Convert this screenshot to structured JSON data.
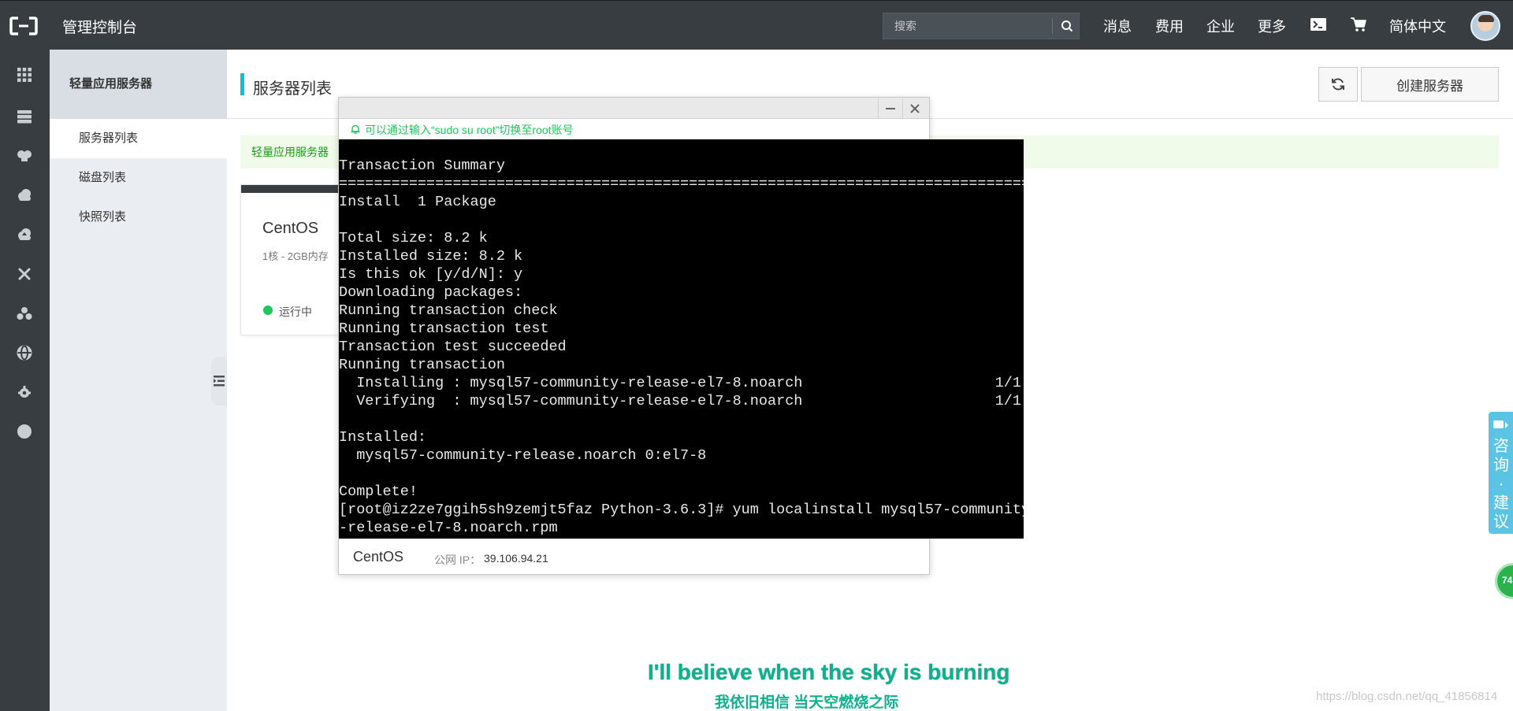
{
  "header": {
    "app_title": "管理控制台",
    "search_placeholder": "搜索",
    "nav": [
      "消息",
      "费用",
      "企业",
      "更多"
    ],
    "language": "简体中文"
  },
  "rail_icons": [
    "apps-grid-icon",
    "database-icon",
    "cloud-server-icon",
    "cloud-icon",
    "cloud-upload-icon",
    "tools-icon",
    "cluster-icon",
    "globe-icon",
    "settings-gear-icon",
    "circle-icon"
  ],
  "sidebar": {
    "header": "轻量应用服务器",
    "items": [
      {
        "label": "服务器列表",
        "active": true
      },
      {
        "label": "磁盘列表",
        "active": false
      },
      {
        "label": "快照列表",
        "active": false
      }
    ]
  },
  "main": {
    "page_title": "服务器列表",
    "create_button": "创建服务器",
    "notice": "轻量应用服务器",
    "card": {
      "name": "CentOS",
      "spec": "1核 - 2GB内存",
      "status": "运行中",
      "status_color": "#1ec75a"
    }
  },
  "dialog": {
    "tip": "可以通过输入“sudo su root”切换至root账号",
    "terminal_lines": [
      "Transaction Summary",
      "================================================================================",
      "Install  1 Package",
      "",
      "Total size: 8.2 k",
      "Installed size: 8.2 k",
      "Is this ok [y/d/N]: y",
      "Downloading packages:",
      "Running transaction check",
      "Running transaction test",
      "Transaction test succeeded",
      "Running transaction",
      "  Installing : mysql57-community-release-el7-8.noarch                      1/1",
      "  Verifying  : mysql57-community-release-el7-8.noarch                      1/1",
      "",
      "Installed:",
      "  mysql57-community-release.noarch 0:el7-8",
      "",
      "Complete!",
      "[root@iz2ze7ggih5sh9zemjt5faz Python-3.6.3]# yum localinstall mysql57-community",
      "-release-el7-8.noarch.rpm"
    ],
    "footer_name": "CentOS",
    "footer_ip_label": "公网 IP：",
    "footer_ip": "39.106.94.21"
  },
  "feedback": {
    "label": "咨询·建议"
  },
  "float_badge": "74",
  "subtitle_en": "I'll believe when the sky is burning",
  "subtitle_zh": "我依旧相信 当天空燃烧之际",
  "watermark": "https://blog.csdn.net/qq_41856814",
  "colors": {
    "topbar": "#373d41",
    "accent": "#00c1de",
    "success": "#1ec75a",
    "terminal_bg": "#000000"
  }
}
